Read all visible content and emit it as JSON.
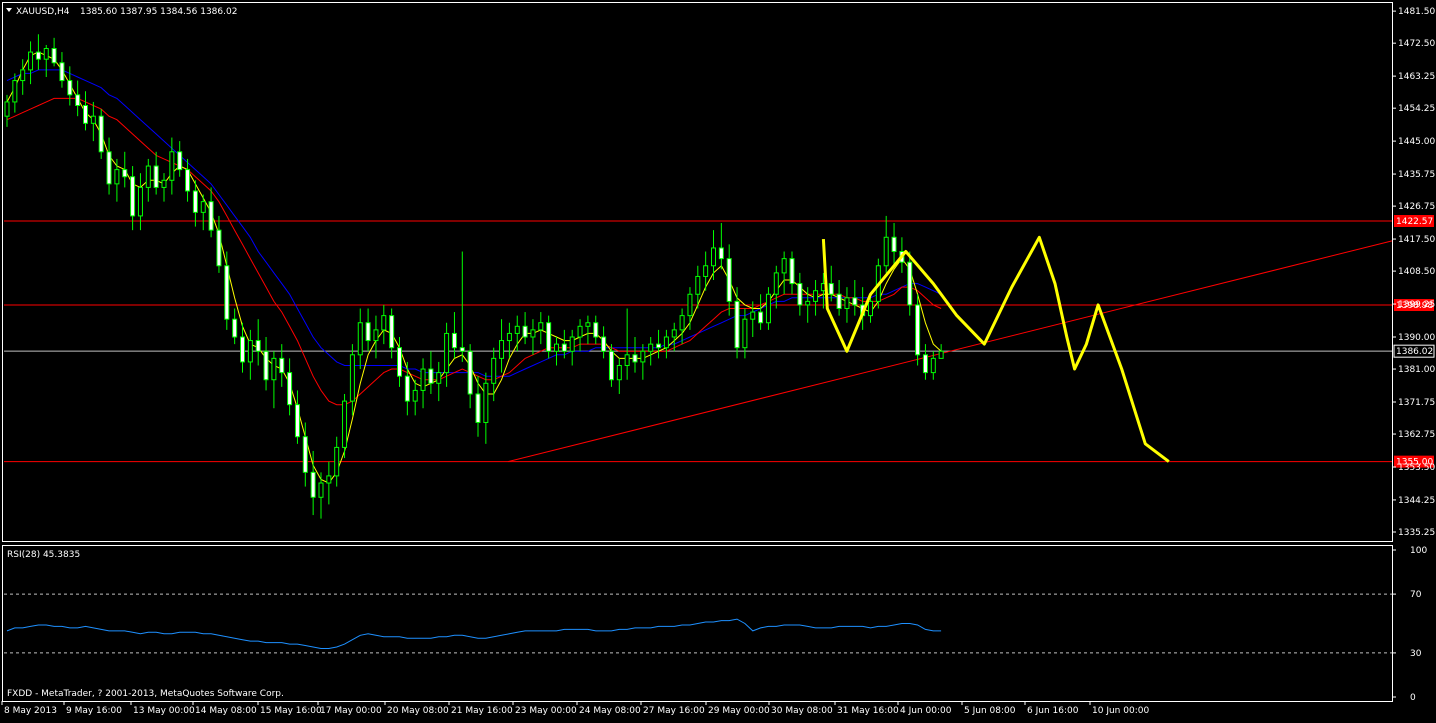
{
  "header": {
    "symbol_label": "XAUUSD,H4",
    "ohlc_text": "1385.60 1387.95 1384.56 1386.02"
  },
  "footer": {
    "copyright": "FXDD - MetaTrader, ? 2001-2013, MetaQuotes Software Corp."
  },
  "rsi": {
    "label": "RSI(28) 45.3835",
    "levels": [
      70,
      30
    ],
    "axis_labels": [
      "100",
      "70",
      "30",
      "0"
    ]
  },
  "colors": {
    "background": "#000000",
    "bull_candle": "#ffffff",
    "bear_candle": "#ffffff",
    "wick": "#00ff00",
    "ma_fast": "#ffff00",
    "ma_mid": "#ff0000",
    "ma_slow": "#0000ff",
    "hline": "#ff0000",
    "trendline": "#ff0000",
    "pattern": "#ffff00",
    "rsi_line": "#1e90ff",
    "current_price": "#c0c0c0"
  },
  "chart_data": {
    "type": "candlestick",
    "ylim": [
      1333.0,
      1483.5
    ],
    "y_ticks": [
      "1481.50",
      "1472.50",
      "1463.25",
      "1454.25",
      "1445.00",
      "1435.75",
      "1426.75",
      "1417.50",
      "1408.50",
      "1399.25",
      "1390.00",
      "1381.00",
      "1371.75",
      "1362.75",
      "1353.50",
      "1344.25",
      "1335.25"
    ],
    "x_ticks": [
      "8 May 2013",
      "9 May 16:00",
      "13 May 00:00",
      "14 May 08:00",
      "15 May 16:00",
      "17 May 00:00",
      "20 May 08:00",
      "21 May 16:00",
      "23 May 00:00",
      "24 May 08:00",
      "27 May 16:00",
      "29 May 00:00",
      "30 May 08:00",
      "31 May 16:00",
      "4 Jun 00:00",
      "5 Jun 08:00",
      "6 Jun 16:00",
      "10 Jun 00:00"
    ],
    "current_price": 1386.02,
    "current_price_label": "1386.02",
    "horizontal_lines": [
      {
        "price": 1422.57,
        "label": "1422.57"
      },
      {
        "price": 1398.98,
        "label": "1398.98"
      },
      {
        "price": 1355.0,
        "label": "1355.00"
      }
    ],
    "candles": [
      [
        1452,
        1458,
        1449,
        1456
      ],
      [
        1456,
        1464,
        1453,
        1462
      ],
      [
        1462,
        1468,
        1458,
        1465
      ],
      [
        1465,
        1473,
        1461,
        1470
      ],
      [
        1470,
        1475,
        1465,
        1468
      ],
      [
        1468,
        1472,
        1463,
        1471
      ],
      [
        1471,
        1474,
        1466,
        1467
      ],
      [
        1467,
        1470,
        1460,
        1462
      ],
      [
        1462,
        1466,
        1455,
        1458
      ],
      [
        1458,
        1462,
        1452,
        1455
      ],
      [
        1455,
        1459,
        1448,
        1450
      ],
      [
        1450,
        1456,
        1445,
        1452
      ],
      [
        1452,
        1454,
        1440,
        1442
      ],
      [
        1442,
        1446,
        1430,
        1433
      ],
      [
        1433,
        1440,
        1428,
        1437
      ],
      [
        1437,
        1442,
        1432,
        1435
      ],
      [
        1435,
        1438,
        1420,
        1424
      ],
      [
        1424,
        1436,
        1420,
        1432
      ],
      [
        1432,
        1440,
        1428,
        1438
      ],
      [
        1438,
        1442,
        1430,
        1432
      ],
      [
        1432,
        1436,
        1428,
        1434
      ],
      [
        1434,
        1446,
        1430,
        1442
      ],
      [
        1442,
        1445,
        1435,
        1437
      ],
      [
        1437,
        1440,
        1428,
        1431
      ],
      [
        1431,
        1434,
        1421,
        1425
      ],
      [
        1425,
        1430,
        1420,
        1428
      ],
      [
        1428,
        1432,
        1418,
        1420
      ],
      [
        1420,
        1424,
        1408,
        1410
      ],
      [
        1410,
        1414,
        1392,
        1395
      ],
      [
        1395,
        1398,
        1388,
        1390
      ],
      [
        1390,
        1394,
        1380,
        1383
      ],
      [
        1383,
        1392,
        1378,
        1389
      ],
      [
        1389,
        1395,
        1382,
        1386
      ],
      [
        1386,
        1390,
        1375,
        1378
      ],
      [
        1378,
        1386,
        1370,
        1384
      ],
      [
        1384,
        1388,
        1376,
        1380
      ],
      [
        1380,
        1384,
        1368,
        1371
      ],
      [
        1371,
        1375,
        1360,
        1362
      ],
      [
        1362,
        1366,
        1348,
        1352
      ],
      [
        1352,
        1358,
        1340,
        1345
      ],
      [
        1345,
        1352,
        1339,
        1349
      ],
      [
        1349,
        1355,
        1343,
        1351
      ],
      [
        1351,
        1362,
        1348,
        1359
      ],
      [
        1359,
        1374,
        1356,
        1372
      ],
      [
        1372,
        1388,
        1368,
        1385
      ],
      [
        1385,
        1398,
        1381,
        1394
      ],
      [
        1394,
        1398,
        1386,
        1389
      ],
      [
        1389,
        1396,
        1384,
        1392
      ],
      [
        1392,
        1399,
        1388,
        1396
      ],
      [
        1396,
        1398,
        1384,
        1387
      ],
      [
        1387,
        1390,
        1376,
        1379
      ],
      [
        1379,
        1383,
        1368,
        1372
      ],
      [
        1372,
        1378,
        1368,
        1375
      ],
      [
        1375,
        1384,
        1370,
        1381
      ],
      [
        1381,
        1386,
        1374,
        1377
      ],
      [
        1377,
        1383,
        1372,
        1380
      ],
      [
        1380,
        1394,
        1376,
        1391
      ],
      [
        1391,
        1397,
        1384,
        1387
      ],
      [
        1387,
        1414,
        1383,
        1386
      ],
      [
        1386,
        1388,
        1370,
        1374
      ],
      [
        1374,
        1379,
        1362,
        1366
      ],
      [
        1366,
        1380,
        1360,
        1377
      ],
      [
        1377,
        1387,
        1372,
        1384
      ],
      [
        1384,
        1395,
        1380,
        1389
      ],
      [
        1389,
        1394,
        1384,
        1391
      ],
      [
        1391,
        1396,
        1386,
        1393
      ],
      [
        1393,
        1397,
        1388,
        1390
      ],
      [
        1390,
        1395,
        1385,
        1392
      ],
      [
        1392,
        1397,
        1388,
        1394
      ],
      [
        1394,
        1396,
        1384,
        1386
      ],
      [
        1386,
        1390,
        1382,
        1388
      ],
      [
        1388,
        1392,
        1384,
        1386
      ],
      [
        1386,
        1392,
        1382,
        1390
      ],
      [
        1390,
        1395,
        1386,
        1393
      ],
      [
        1393,
        1396,
        1388,
        1394
      ],
      [
        1394,
        1396,
        1388,
        1390
      ],
      [
        1390,
        1393,
        1384,
        1386
      ],
      [
        1386,
        1388,
        1376,
        1378
      ],
      [
        1378,
        1384,
        1374,
        1382
      ],
      [
        1382,
        1398,
        1378,
        1385
      ],
      [
        1385,
        1390,
        1380,
        1383
      ],
      [
        1383,
        1388,
        1378,
        1386
      ],
      [
        1386,
        1390,
        1382,
        1388
      ],
      [
        1388,
        1392,
        1384,
        1387
      ],
      [
        1387,
        1392,
        1384,
        1390
      ],
      [
        1390,
        1394,
        1386,
        1392
      ],
      [
        1392,
        1398,
        1388,
        1396
      ],
      [
        1396,
        1404,
        1392,
        1402
      ],
      [
        1402,
        1410,
        1398,
        1407
      ],
      [
        1407,
        1414,
        1403,
        1410
      ],
      [
        1410,
        1420,
        1406,
        1415
      ],
      [
        1415,
        1422,
        1409,
        1412
      ],
      [
        1412,
        1416,
        1396,
        1400
      ],
      [
        1400,
        1404,
        1384,
        1387
      ],
      [
        1387,
        1398,
        1384,
        1395
      ],
      [
        1395,
        1400,
        1390,
        1397
      ],
      [
        1397,
        1402,
        1392,
        1394
      ],
      [
        1394,
        1404,
        1392,
        1402
      ],
      [
        1402,
        1410,
        1398,
        1408
      ],
      [
        1408,
        1414,
        1402,
        1412
      ],
      [
        1412,
        1414,
        1402,
        1405
      ],
      [
        1405,
        1408,
        1396,
        1399
      ],
      [
        1399,
        1404,
        1394,
        1400
      ],
      [
        1400,
        1406,
        1396,
        1403
      ],
      [
        1403,
        1408,
        1398,
        1405
      ],
      [
        1405,
        1410,
        1400,
        1402
      ],
      [
        1402,
        1406,
        1396,
        1398
      ],
      [
        1398,
        1404,
        1394,
        1401
      ],
      [
        1401,
        1406,
        1396,
        1399
      ],
      [
        1399,
        1404,
        1392,
        1396
      ],
      [
        1396,
        1402,
        1394,
        1400
      ],
      [
        1400,
        1412,
        1398,
        1410
      ],
      [
        1410,
        1424,
        1408,
        1418
      ],
      [
        1418,
        1422,
        1410,
        1414
      ],
      [
        1414,
        1418,
        1408,
        1411
      ],
      [
        1411,
        1414,
        1396,
        1399
      ],
      [
        1399,
        1402,
        1382,
        1385
      ],
      [
        1385,
        1388,
        1378,
        1380
      ],
      [
        1380,
        1386,
        1378,
        1384
      ],
      [
        1384,
        1388,
        1384,
        1386
      ]
    ],
    "ma_fast": [
      1456,
      1460,
      1465,
      1469,
      1470,
      1469,
      1468,
      1465,
      1461,
      1457,
      1453,
      1451,
      1447,
      1441,
      1438,
      1437,
      1433,
      1432,
      1434,
      1434,
      1433,
      1436,
      1438,
      1437,
      1433,
      1429,
      1425,
      1419,
      1410,
      1401,
      1393,
      1388,
      1387,
      1384,
      1382,
      1381,
      1377,
      1370,
      1362,
      1354,
      1350,
      1349,
      1352,
      1358,
      1367,
      1377,
      1385,
      1389,
      1392,
      1391,
      1387,
      1381,
      1377,
      1376,
      1377,
      1378,
      1381,
      1384,
      1385,
      1382,
      1377,
      1374,
      1374,
      1378,
      1384,
      1388,
      1391,
      1391,
      1392,
      1391,
      1390,
      1389,
      1389,
      1390,
      1391,
      1391,
      1389,
      1386,
      1384,
      1384,
      1384,
      1384,
      1385,
      1386,
      1387,
      1389,
      1391,
      1394,
      1399,
      1404,
      1408,
      1410,
      1406,
      1401,
      1399,
      1398,
      1398,
      1400,
      1403,
      1406,
      1406,
      1404,
      1402,
      1401,
      1402,
      1402,
      1401,
      1400,
      1399,
      1398,
      1397,
      1400,
      1405,
      1409,
      1412,
      1409,
      1402,
      1394,
      1388,
      1386
    ],
    "ma_mid": [
      1451,
      1452,
      1453,
      1454,
      1455,
      1456,
      1457,
      1457,
      1457,
      1457,
      1456,
      1455,
      1454,
      1452,
      1451,
      1449,
      1447,
      1445,
      1443,
      1441,
      1440,
      1439,
      1438,
      1437,
      1435,
      1433,
      1431,
      1428,
      1424,
      1420,
      1416,
      1412,
      1408,
      1404,
      1400,
      1397,
      1393,
      1389,
      1384,
      1379,
      1375,
      1372,
      1371,
      1371,
      1372,
      1374,
      1376,
      1378,
      1380,
      1381,
      1381,
      1380,
      1379,
      1378,
      1378,
      1378,
      1379,
      1380,
      1381,
      1380,
      1379,
      1378,
      1378,
      1379,
      1380,
      1382,
      1384,
      1385,
      1386,
      1387,
      1387,
      1387,
      1387,
      1388,
      1388,
      1388,
      1388,
      1387,
      1386,
      1386,
      1386,
      1386,
      1386,
      1386,
      1386,
      1387,
      1388,
      1389,
      1391,
      1393,
      1395,
      1397,
      1398,
      1398,
      1398,
      1398,
      1399,
      1400,
      1401,
      1402,
      1402,
      1402,
      1402,
      1402,
      1402,
      1402,
      1402,
      1401,
      1401,
      1400,
      1400,
      1400,
      1401,
      1402,
      1404,
      1404,
      1403,
      1401,
      1399,
      1398
    ],
    "ma_slow": [
      1462,
      1463,
      1464,
      1464,
      1465,
      1465,
      1465,
      1465,
      1464,
      1463,
      1462,
      1461,
      1460,
      1458,
      1457,
      1455,
      1453,
      1451,
      1449,
      1447,
      1445,
      1443,
      1441,
      1439,
      1437,
      1435,
      1433,
      1430,
      1427,
      1424,
      1421,
      1418,
      1414,
      1411,
      1408,
      1405,
      1402,
      1398,
      1394,
      1390,
      1387,
      1385,
      1383,
      1382,
      1382,
      1382,
      1382,
      1382,
      1382,
      1382,
      1382,
      1381,
      1381,
      1380,
      1380,
      1380,
      1380,
      1380,
      1380,
      1380,
      1380,
      1379,
      1379,
      1379,
      1379,
      1380,
      1381,
      1382,
      1383,
      1384,
      1385,
      1385,
      1386,
      1386,
      1386,
      1387,
      1387,
      1387,
      1387,
      1387,
      1387,
      1387,
      1387,
      1387,
      1388,
      1388,
      1389,
      1390,
      1391,
      1392,
      1393,
      1394,
      1395,
      1396,
      1396,
      1397,
      1398,
      1399,
      1400,
      1400,
      1401,
      1401,
      1401,
      1401,
      1401,
      1401,
      1401,
      1401,
      1401,
      1401,
      1401,
      1402,
      1402,
      1403,
      1404,
      1405,
      1405,
      1404,
      1403,
      1402
    ],
    "pattern_points": [
      [
        1422,
        1417.5
      ],
      [
        1421,
        1398
      ],
      [
        1425,
        1386
      ],
      [
        1428,
        1402
      ],
      [
        1432,
        1414
      ],
      [
        1435,
        1405
      ],
      [
        1440,
        1396
      ],
      [
        1444,
        1388
      ],
      [
        1448,
        1404
      ],
      [
        1452,
        1418
      ],
      [
        1455,
        1405
      ],
      [
        1457,
        1390
      ],
      [
        1458,
        1381
      ],
      [
        1460,
        1388
      ],
      [
        1462,
        1399
      ],
      [
        1465,
        1381
      ],
      [
        1468,
        1360
      ],
      [
        1470,
        1355
      ]
    ],
    "trendline": {
      "from": [
        1351.5,
        1355.0
      ],
      "to": [
        1395,
        1417.0
      ]
    },
    "rsi_ylim": [
      0,
      100
    ],
    "rsi_values": [
      45,
      47,
      47,
      48,
      49,
      49,
      48,
      48,
      47,
      47,
      48,
      47,
      46,
      45,
      45,
      45,
      44,
      43,
      44,
      44,
      43,
      43,
      44,
      44,
      44,
      43,
      43,
      42,
      41,
      40,
      39,
      38,
      38,
      37,
      37,
      37,
      36,
      36,
      35,
      34,
      33,
      33,
      34,
      36,
      39,
      42,
      43,
      42,
      41,
      41,
      41,
      40,
      40,
      40,
      40,
      41,
      41,
      42,
      42,
      41,
      40,
      40,
      41,
      42,
      43,
      44,
      45,
      45,
      45,
      45,
      45,
      46,
      46,
      46,
      46,
      45,
      45,
      45,
      46,
      46,
      47,
      47,
      47,
      48,
      48,
      48,
      49,
      49,
      50,
      51,
      51,
      52,
      52,
      53,
      50,
      45,
      47,
      48,
      48,
      49,
      49,
      49,
      48,
      47,
      47,
      47,
      48,
      48,
      48,
      48,
      47,
      48,
      48,
      49,
      50,
      50,
      49,
      46,
      45,
      45
    ]
  }
}
